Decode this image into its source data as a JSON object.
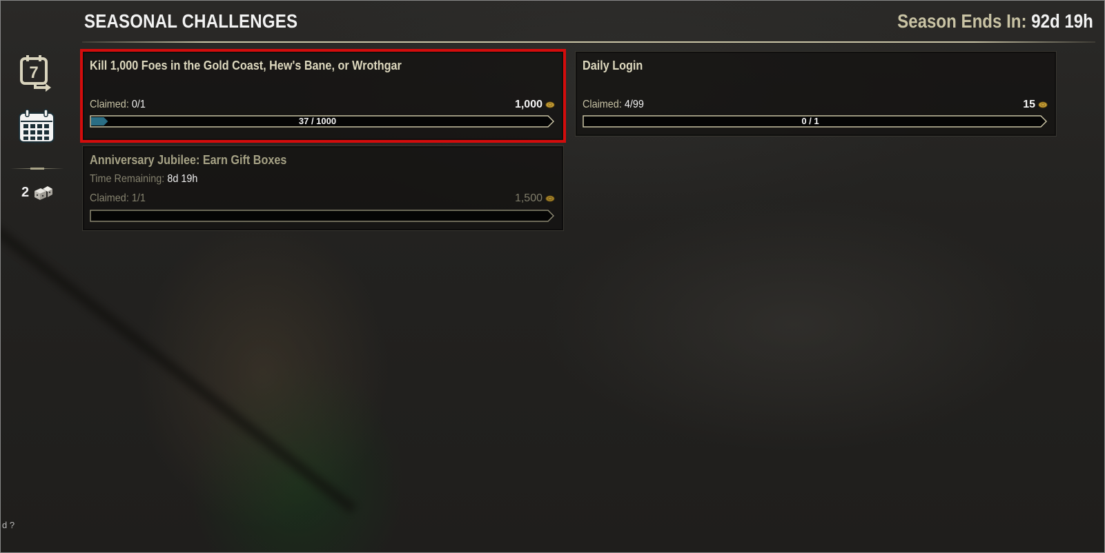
{
  "header": {
    "title": "SEASONAL CHALLENGES",
    "season_ends_label": "Season Ends In:",
    "season_ends_value": "92d 19h"
  },
  "sidebar": {
    "items": [
      {
        "name": "weekly-calendar-icon",
        "label": "7",
        "active": false
      },
      {
        "name": "calendar-grid-icon",
        "active": true
      }
    ],
    "gift_count": "2",
    "gift_icon": "dice-gift-icon"
  },
  "cards": [
    {
      "title": "Kill 1,000 Foes in the Gold Coast, Hew's Bane, or Wrothgar",
      "claimed_label": "Claimed:",
      "claimed_value": "0/1",
      "reward": "1,000",
      "progress_text": "37 / 1000",
      "progress": 0.037,
      "highlighted": true
    },
    {
      "title": "Daily Login",
      "claimed_label": "Claimed:",
      "claimed_value": "4/99",
      "reward": "15",
      "progress_text": "0 / 1",
      "progress": 0
    },
    {
      "title": "Anniversary Jubilee: Earn Gift Boxes",
      "time_label": "Time Remaining:",
      "time_value": "8d 19h",
      "claimed_label": "Claimed:",
      "claimed_value": "1/1",
      "reward": "1,500",
      "progress_text": "",
      "progress": 0,
      "completed": true
    }
  ],
  "colors": {
    "highlight": "#d40c0c",
    "progress_fill": "#2a6e85",
    "gold_text": "#ddd8be"
  },
  "corner_text": "d ?"
}
